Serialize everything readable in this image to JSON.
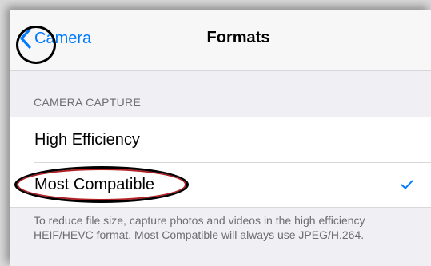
{
  "navbar": {
    "back_label": "Camera",
    "title": "Formats"
  },
  "section": {
    "header": "CAMERA CAPTURE",
    "options": [
      {
        "label": "High Efficiency",
        "selected": false
      },
      {
        "label": "Most Compatible",
        "selected": true
      }
    ],
    "footer": "To reduce file size, capture photos and videos in the high efficiency HEIF/HEVC format. Most Compatible will always use JPEG/H.264."
  },
  "colors": {
    "accent": "#007aff",
    "annotation": "#b21f24"
  },
  "icons": {
    "back": "chevron-left-icon",
    "selected": "checkmark-icon"
  }
}
